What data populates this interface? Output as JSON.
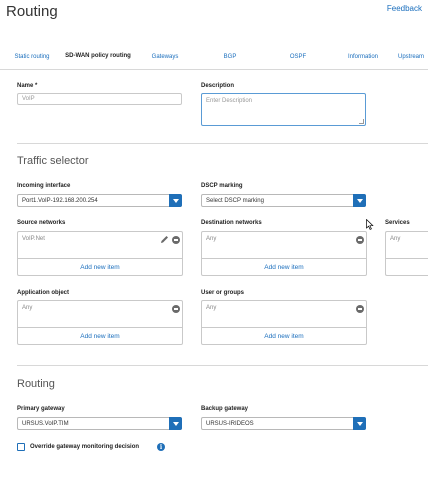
{
  "header": {
    "title": "Routing",
    "feedback_label": "Feedback"
  },
  "tabs": [
    {
      "label": "Static routing"
    },
    {
      "label": "SD-WAN policy routing"
    },
    {
      "label": "Gateways"
    },
    {
      "label": "BGP"
    },
    {
      "label": "OSPF"
    },
    {
      "label": "Information"
    },
    {
      "label": "Upstream"
    }
  ],
  "form": {
    "name_label": "Name *",
    "name_value": "VoIP",
    "description_label": "Description",
    "description_placeholder": "Enter Description"
  },
  "traffic_selector": {
    "title": "Traffic selector",
    "incoming_interface_label": "Incoming interface",
    "incoming_interface_value": "Port1.VoIP-192.168.200.254",
    "dscp_label": "DSCP marking",
    "dscp_value": "Select DSCP marking",
    "source_networks_label": "Source networks",
    "source_networks_item": "VoIP.Net",
    "source_networks_add": "Add new item",
    "destination_networks_label": "Destination networks",
    "destination_networks_item": "Any",
    "destination_networks_add": "Add new item",
    "services_label": "Services",
    "services_item": "Any",
    "application_object_label": "Application object",
    "application_object_item": "Any",
    "application_object_add": "Add new item",
    "user_groups_label": "User or groups",
    "user_groups_item": "Any",
    "user_groups_add": "Add new item"
  },
  "routing": {
    "title": "Routing",
    "primary_gateway_label": "Primary gateway",
    "primary_gateway_value": "URSUS.VoIP.TIM",
    "backup_gateway_label": "Backup gateway",
    "backup_gateway_value": "URSUS-IRIDEOS",
    "override_label": "Override gateway monitoring decision"
  },
  "colors": {
    "accent": "#1f6fb8",
    "link": "#1a6ebd",
    "border": "#c9c9c9"
  },
  "icons": [
    "minus-circle-icon",
    "pencil-icon",
    "info-icon",
    "chevron-down-icon",
    "mouse-cursor-icon"
  ]
}
